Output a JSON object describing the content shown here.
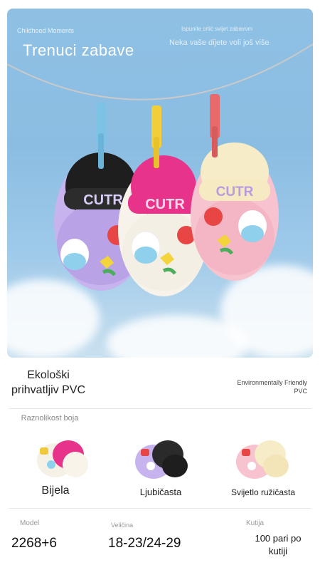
{
  "hero": {
    "tag": "Childhood Moments",
    "title": "Trenuci zabave",
    "subtitle_small": "Ispunite crtić svijet zabavom",
    "subtitle": "Neka vaše dijete voli još više",
    "brand_strap": "CUTR",
    "colors": {
      "sky": "#8fc0e4",
      "clip_blue": "#7cc3e6",
      "clip_yellow": "#f2cf3a",
      "clip_red": "#e86a6a"
    }
  },
  "material": {
    "title": "Ekološki prihvatljiv PVC",
    "english": "Environmentally Friendly PVC"
  },
  "colors_section": {
    "title": "Raznolikost boja",
    "options": [
      {
        "label": "Bijela",
        "accent": "#e8338a"
      },
      {
        "label": "Ljubičasta",
        "accent": "#b8a6e6"
      },
      {
        "label": "Svijetlo ružičasta",
        "accent": "#f6c3cf"
      }
    ]
  },
  "specs": {
    "model_label": "Model",
    "model_value": "2268+6",
    "size_label": "Veličina",
    "size_value": "18-23/24-29",
    "box_label": "Kutija",
    "box_value": "100 pari po kutiji"
  }
}
